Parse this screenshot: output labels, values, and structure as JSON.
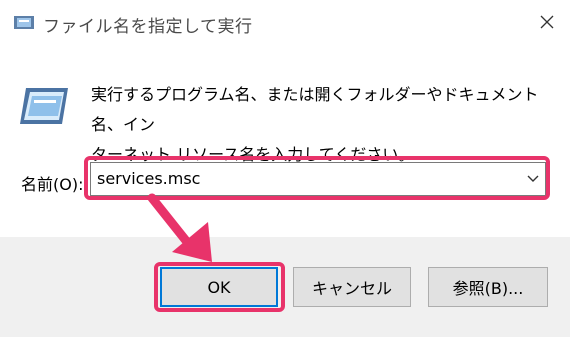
{
  "window": {
    "title": "ファイル名を指定して実行"
  },
  "dialog": {
    "description": "実行するプログラム名、または開くフォルダーやドキュメント名、イン\nターネット リソース名を入力してください。",
    "open_label": "名前(O):",
    "open_value": "services.msc"
  },
  "buttons": {
    "ok_label": "OK",
    "cancel_label": "キャンセル",
    "browse_label": "参照(B)..."
  },
  "colors": {
    "highlight": "#e8336a",
    "ok_border": "#0078d7",
    "footer_bg": "#f0f0f0"
  },
  "icons": [
    "run-app-icon",
    "close-icon",
    "run-dialog-icon",
    "chevron-down-icon",
    "pointer-arrow"
  ]
}
